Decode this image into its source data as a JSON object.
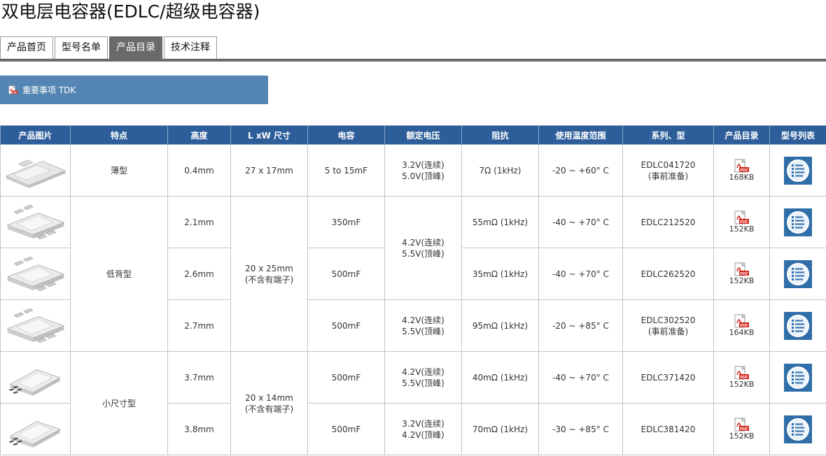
{
  "page": {
    "title": "双电层电容器(EDLC/超级电容器)"
  },
  "tabs": [
    {
      "label": "产品首页",
      "active": false
    },
    {
      "label": "型号名单",
      "active": false
    },
    {
      "label": "产品目录",
      "active": true
    },
    {
      "label": "技术注释",
      "active": false
    }
  ],
  "notice": {
    "label": "重要事项 TDK"
  },
  "table": {
    "headers": [
      "产品图片",
      "特点",
      "高度",
      "L xW 尺寸",
      "电容",
      "额定电压",
      "阻抗",
      "使用温度范围",
      "系列、型",
      "产品目录",
      "型号列表"
    ],
    "groups": {
      "thin": "薄型",
      "low_profile": "低背型",
      "small": "小尺寸型"
    },
    "sizes": {
      "s1": "27 x 17mm",
      "s2_line1": "20 x 25mm",
      "s2_line2": "(不含有端子)",
      "s3_line1": "20 x 14mm",
      "s3_line2": "(不含有端子)"
    },
    "voltages": {
      "v1_line1": "3.2V(连续)",
      "v1_line2": "5.0V(顶峰)",
      "v2_line1": "4.2V(连续)",
      "v2_line2": "5.5V(顶峰)",
      "v3_line1": "4.2V(连续)",
      "v3_line2": "5.5V(顶峰)",
      "v4_line1": "4.2V(连续)",
      "v4_line2": "5.5V(顶峰)",
      "v5_line1": "3.2V(连续)",
      "v5_line2": "4.2V(顶峰)"
    },
    "rows": [
      {
        "height": "0.4mm",
        "capacitance": "5 to 15mF",
        "impedance": "7Ω (1kHz)",
        "temp": "-20 ~ +60° C",
        "series_line1": "EDLC041720",
        "series_line2": "(事前准备)",
        "pdf_size": "168KB"
      },
      {
        "height": "2.1mm",
        "capacitance": "350mF",
        "impedance": "55mΩ (1kHz)",
        "temp": "-40 ~ +70° C",
        "series_line1": "EDLC212520",
        "series_line2": "",
        "pdf_size": "152KB"
      },
      {
        "height": "2.6mm",
        "capacitance": "500mF",
        "impedance": "35mΩ (1kHz)",
        "temp": "-40 ~ +70° C",
        "series_line1": "EDLC262520",
        "series_line2": "",
        "pdf_size": "152KB"
      },
      {
        "height": "2.7mm",
        "capacitance": "500mF",
        "impedance": "95mΩ (1kHz)",
        "temp": "-20 ~ +85° C",
        "series_line1": "EDLC302520",
        "series_line2": "(事前准备)",
        "pdf_size": "164KB"
      },
      {
        "height": "3.7mm",
        "capacitance": "500mF",
        "impedance": "40mΩ (1kHz)",
        "temp": "-40 ~ +70° C",
        "series_line1": "EDLC371420",
        "series_line2": "",
        "pdf_size": "152KB"
      },
      {
        "height": "3.8mm",
        "capacitance": "500mF",
        "impedance": "70mΩ (1kHz)",
        "temp": "-30 ~ +85° C",
        "series_line1": "EDLC381420",
        "series_line2": "",
        "pdf_size": "152KB"
      }
    ]
  },
  "icons": {
    "pdf": "pdf-icon",
    "list": "list-icon",
    "capacitor": "capacitor-image"
  },
  "colors": {
    "header_bg": "#2d5e9a",
    "notice_bg": "#5586b3",
    "tab_active": "#6a6a6a",
    "pdf_red": "#d6261c",
    "list_blue": "#2f6ea8"
  }
}
